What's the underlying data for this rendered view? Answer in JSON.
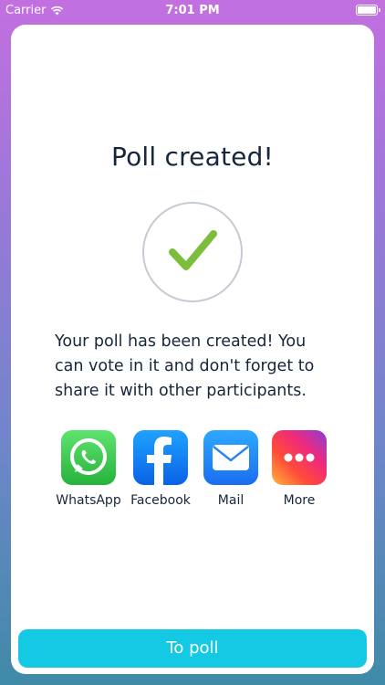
{
  "status_bar": {
    "carrier": "Carrier",
    "time": "7:01 PM",
    "wifi_icon": "wifi-icon",
    "battery_icon": "battery-icon"
  },
  "screen": {
    "title": "Poll created!",
    "success_icon": "checkmark-icon",
    "message": "Your poll has been created! You can vote in it and don't forget to share it with other participants.",
    "share_options": [
      {
        "label": "WhatsApp",
        "icon": "whatsapp-icon",
        "color": "#2fc146"
      },
      {
        "label": "Facebook",
        "icon": "facebook-icon",
        "color": "#1877f2"
      },
      {
        "label": "Mail",
        "icon": "mail-icon",
        "color": "#1f86f5"
      },
      {
        "label": "More",
        "icon": "more-icon",
        "color": "#f0356e"
      }
    ],
    "button_label": "To poll"
  },
  "colors": {
    "accent": "#13c9e4",
    "check": "#7cbd3c",
    "text": "#17263b"
  }
}
